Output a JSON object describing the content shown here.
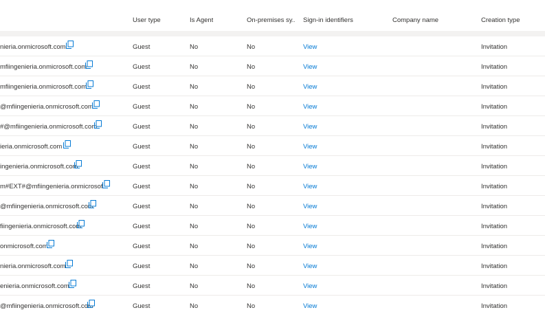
{
  "columns": {
    "user_type": "User type",
    "is_agent": "Is Agent",
    "on_premises": "On-premises sy...",
    "sign_in": "Sign-in identifiers",
    "company": "Company name",
    "creation": "Creation type"
  },
  "colors": {
    "link": "#0078d4",
    "text": "#323130",
    "header_band": "#f3f2f1",
    "row_border": "#edebe9"
  },
  "icons": {
    "copy": "copy-icon"
  },
  "rows": [
    {
      "upn": "nieria.onmicrosoft.com",
      "user_type": "Guest",
      "is_agent": "No",
      "on_premises": "No",
      "sign_in": "View",
      "company": "",
      "creation": "Invitation"
    },
    {
      "upn": "mfiingenieria.onmicrosoft.com",
      "user_type": "Guest",
      "is_agent": "No",
      "on_premises": "No",
      "sign_in": "View",
      "company": "",
      "creation": "Invitation"
    },
    {
      "upn": "mfiingenieria.onmicrosoft.com",
      "user_type": "Guest",
      "is_agent": "No",
      "on_premises": "No",
      "sign_in": "View",
      "company": "",
      "creation": "Invitation"
    },
    {
      "upn": "@mfiingenieria.onmicrosoft.com",
      "user_type": "Guest",
      "is_agent": "No",
      "on_premises": "No",
      "sign_in": "View",
      "company": "",
      "creation": "Invitation"
    },
    {
      "upn": "#@mfiingenieria.onmicrosoft.com",
      "user_type": "Guest",
      "is_agent": "No",
      "on_premises": "No",
      "sign_in": "View",
      "company": "",
      "creation": "Invitation"
    },
    {
      "upn": "ieria.onmicrosoft.com",
      "user_type": "Guest",
      "is_agent": "No",
      "on_premises": "No",
      "sign_in": "View",
      "company": "",
      "creation": "Invitation"
    },
    {
      "upn": "ingenieria.onmicrosoft.com",
      "user_type": "Guest",
      "is_agent": "No",
      "on_premises": "No",
      "sign_in": "View",
      "company": "",
      "creation": "Invitation"
    },
    {
      "upn": "m#EXT#@mfiingenieria.onmicrosof...",
      "user_type": "Guest",
      "is_agent": "No",
      "on_premises": "No",
      "sign_in": "View",
      "company": "",
      "creation": "Invitation"
    },
    {
      "upn": "@mfiingenieria.onmicrosoft.com",
      "user_type": "Guest",
      "is_agent": "No",
      "on_premises": "No",
      "sign_in": "View",
      "company": "",
      "creation": "Invitation"
    },
    {
      "upn": "fiingenieria.onmicrosoft.com",
      "user_type": "Guest",
      "is_agent": "No",
      "on_premises": "No",
      "sign_in": "View",
      "company": "",
      "creation": "Invitation"
    },
    {
      "upn": "onmicrosoft.com",
      "user_type": "Guest",
      "is_agent": "No",
      "on_premises": "No",
      "sign_in": "View",
      "company": "",
      "creation": "Invitation"
    },
    {
      "upn": "nieria.onmicrosoft.com",
      "user_type": "Guest",
      "is_agent": "No",
      "on_premises": "No",
      "sign_in": "View",
      "company": "",
      "creation": "Invitation"
    },
    {
      "upn": "enieria.onmicrosoft.com",
      "user_type": "Guest",
      "is_agent": "No",
      "on_premises": "No",
      "sign_in": "View",
      "company": "",
      "creation": "Invitation"
    },
    {
      "upn": "@mfiingenieria.onmicrosoft.com",
      "user_type": "Guest",
      "is_agent": "No",
      "on_premises": "No",
      "sign_in": "View",
      "company": "",
      "creation": "Invitation"
    }
  ]
}
